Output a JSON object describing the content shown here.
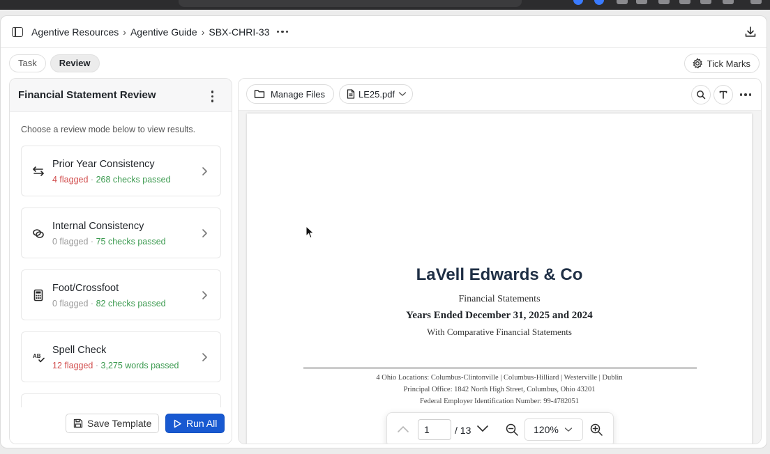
{
  "breadcrumb": {
    "items": [
      "Agentive Resources",
      "Agentive Guide",
      "SBX-CHRI-33"
    ],
    "separator": "›"
  },
  "tabs": [
    {
      "label": "Task",
      "active": false
    },
    {
      "label": "Review",
      "active": true
    }
  ],
  "tick_marks": {
    "label": "Tick Marks",
    "icon": "gear-icon"
  },
  "left_panel": {
    "title": "Financial Statement Review",
    "hint": "Choose a review mode below to view results.",
    "modes": [
      {
        "title": "Prior Year Consistency",
        "flagged": "4 flagged",
        "flag_color": "red",
        "passed": "268 checks passed",
        "icon": "swap-arrows-icon"
      },
      {
        "title": "Internal Consistency",
        "flagged": "0 flagged",
        "flag_color": "gray",
        "passed": "75 checks passed",
        "icon": "link-rings-icon"
      },
      {
        "title": "Foot/Crossfoot",
        "flagged": "0 flagged",
        "flag_color": "gray",
        "passed": "82 checks passed",
        "icon": "calculator-icon"
      },
      {
        "title": "Spell Check",
        "flagged": "12 flagged",
        "flag_color": "red",
        "passed": "3,275 words passed",
        "icon": "spell-check-icon"
      }
    ],
    "mid_dot": "·",
    "save_template_label": "Save Template",
    "run_all_label": "Run All"
  },
  "viewer": {
    "manage_files_label": "Manage Files",
    "file_name": "LE25.pdf",
    "document": {
      "company": "LaVell Edwards & Co",
      "line1": "Financial Statements",
      "line2": "Years Ended December 31, 2025 and 2024",
      "line3": "With Comparative Financial Statements",
      "footer1": "4 Ohio Locations: Columbus-Clintonville  |  Columbus-Hilliard  |  Westerville  |  Dublin",
      "footer2": "Principal Office: 1842 North High Street, Columbus, Ohio 43201",
      "footer3": "Federal Employer Identification Number: 99-4782051"
    },
    "pager": {
      "current_page": "1",
      "total": "/ 13",
      "zoom": "120%"
    }
  },
  "colors": {
    "accent": "#1859d1",
    "flag_red": "#d14b4b",
    "pass_green": "#3b9a4f",
    "title_navy": "#1f2f45"
  }
}
